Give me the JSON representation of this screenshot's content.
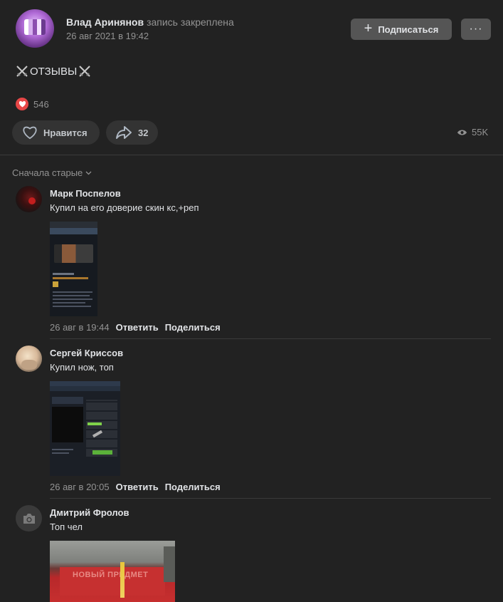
{
  "post": {
    "author_name": "Влад Аринянов",
    "pinned_label": "запись закреплена",
    "date": "26 авг 2021 в 19:42",
    "subscribe_label": "Подписаться",
    "more_label": "···",
    "text": "ОТЗЫВЫ",
    "reaction_count": "546",
    "like_label": "Нравится",
    "share_count": "32",
    "views_count": "55K"
  },
  "comments_section": {
    "sort_label": "Сначала старые"
  },
  "comments": [
    {
      "author": "Марк Поспелов",
      "text": "Купил на его доверие скин кс,+реп",
      "date": "26 авг в 19:44",
      "reply_label": "Ответить",
      "share_label": "Поделиться"
    },
    {
      "author": "Сергей Криссов",
      "text": "Купил нож, топ",
      "date": "26 авг в 20:05",
      "reply_label": "Ответить",
      "share_label": "Поделиться"
    },
    {
      "author": "Дмитрий Фролов",
      "text": "Топ чел",
      "photo_caption": "НОВЫЙ ПРЕДМЕТ"
    }
  ],
  "colors": {
    "background": "#222222",
    "button": "#555555",
    "pill": "#333333",
    "heart": "#e64646",
    "muted_text": "#939393"
  }
}
